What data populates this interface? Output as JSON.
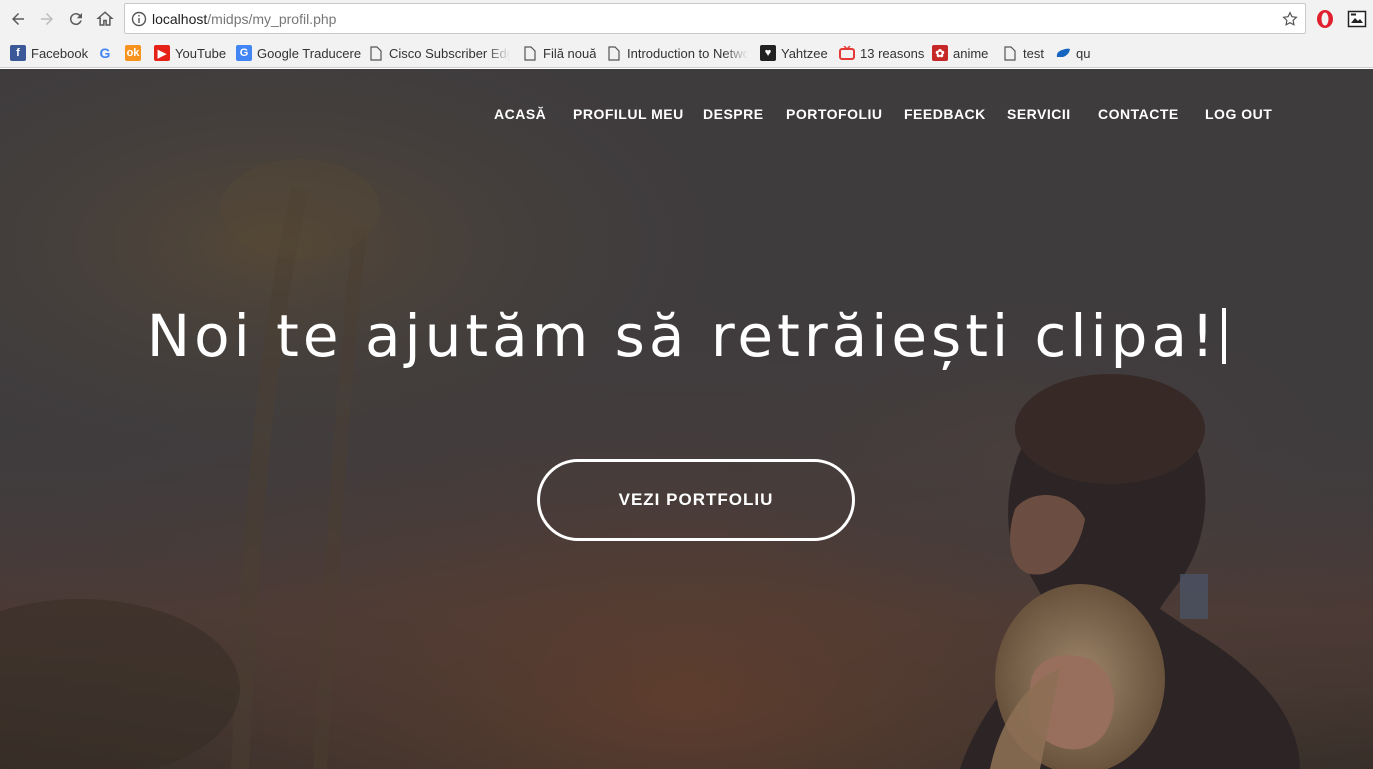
{
  "browser": {
    "url_host": "localhost",
    "url_path": "/midps/my_profil.php",
    "bookmarks": [
      {
        "label": "Facebook",
        "icon": "facebook-icon",
        "color": "#3b5998"
      },
      {
        "label": "",
        "icon": "google-icon",
        "color": "#4285f4"
      },
      {
        "label": "",
        "icon": "odnoklassniki-icon",
        "color": "#f7931e"
      },
      {
        "label": "YouTube",
        "icon": "youtube-icon",
        "color": "#e62117"
      },
      {
        "label": "Google Traducere",
        "icon": "google-translate-icon",
        "color": "#4285f4"
      },
      {
        "label": "Cisco Subscriber Edge",
        "icon": "page-icon",
        "color": "#666666"
      },
      {
        "label": "Filă nouă",
        "icon": "page-icon",
        "color": "#666666"
      },
      {
        "label": "Introduction to Netwo",
        "icon": "page-icon",
        "color": "#666666"
      },
      {
        "label": "Yahtzee",
        "icon": "yahtzee-icon",
        "color": "#b00020"
      },
      {
        "label": "13 reasons",
        "icon": "tv-icon",
        "color": "#e53935"
      },
      {
        "label": "anime",
        "icon": "anime-icon",
        "color": "#c62828"
      },
      {
        "label": "test",
        "icon": "page-icon",
        "color": "#666666"
      },
      {
        "label": "qu",
        "icon": "cloud-icon",
        "color": "#1565c0"
      }
    ]
  },
  "site": {
    "nav": [
      "ACASĂ",
      "PROFILUL MEU",
      "DESPRE",
      "PORTOFOLIU",
      "FEEDBACK",
      "SERVICII",
      "CONTACTE",
      "LOG OUT"
    ],
    "headline": "Noi te ajutăm să retrăiești clipa!",
    "cta_label": "VEZI PORTFOLIU"
  }
}
